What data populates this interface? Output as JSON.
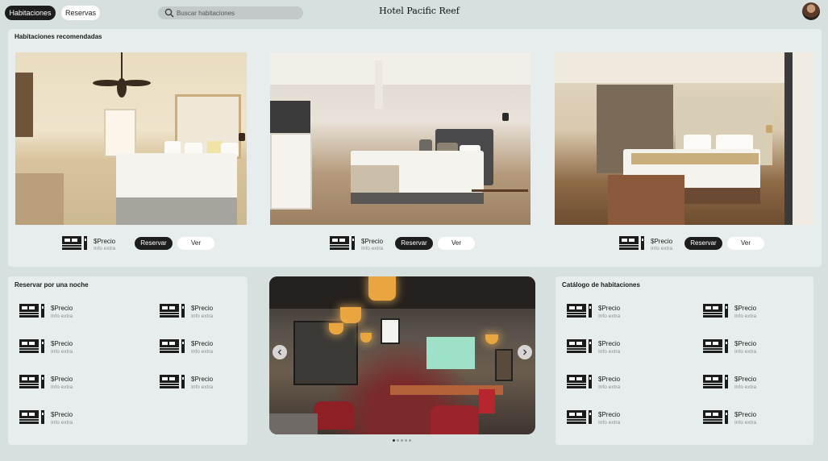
{
  "header": {
    "tabs": [
      {
        "label": "Habitaciones",
        "active": true
      },
      {
        "label": "Reservas",
        "active": false
      }
    ],
    "search_placeholder": "Buscar habitaciones",
    "brand": "Hotel Pacific Reef"
  },
  "recommended": {
    "title": "Habitaciones recomendadas",
    "cards": [
      {
        "price": "$Precio",
        "extra": "Info extra",
        "reserve_label": "Reservar",
        "view_label": "Ver"
      },
      {
        "price": "$Precio",
        "extra": "Info extra",
        "reserve_label": "Reservar",
        "view_label": "Ver"
      },
      {
        "price": "$Precio",
        "extra": "Info extra",
        "reserve_label": "Reservar",
        "view_label": "Ver"
      }
    ]
  },
  "one_night": {
    "title": "Reservar por una noche",
    "items": [
      {
        "price": "$Precio",
        "extra": "Info extra"
      },
      {
        "price": "$Precio",
        "extra": "Info extra"
      },
      {
        "price": "$Precio",
        "extra": "Info extra"
      },
      {
        "price": "$Precio",
        "extra": "Info extra"
      },
      {
        "price": "$Precio",
        "extra": "Info extra"
      },
      {
        "price": "$Precio",
        "extra": "Info extra"
      },
      {
        "price": "$Precio",
        "extra": "Info extra"
      }
    ]
  },
  "catalog": {
    "title": "Catálogo de habitaciones",
    "items": [
      {
        "price": "$Precio",
        "extra": "Info extra"
      },
      {
        "price": "$Precio",
        "extra": "Info extra"
      },
      {
        "price": "$Precio",
        "extra": "Info extra"
      },
      {
        "price": "$Precio",
        "extra": "Info extra"
      },
      {
        "price": "$Precio",
        "extra": "Info extra"
      },
      {
        "price": "$Precio",
        "extra": "Info extra"
      },
      {
        "price": "$Precio",
        "extra": "Info extra"
      },
      {
        "price": "$Precio",
        "extra": "Info extra"
      }
    ]
  },
  "carousel": {
    "slide_count": 5,
    "active_slide": 1
  },
  "colors": {
    "background": "#d6e0df",
    "panel": "#e7edec",
    "primary_button": "#1d1d1d",
    "secondary_button": "#ffffff",
    "muted_text": "#8a8f8f"
  },
  "icons": [
    "search-icon",
    "bed-icon",
    "chevron-left-icon",
    "chevron-right-icon"
  ]
}
